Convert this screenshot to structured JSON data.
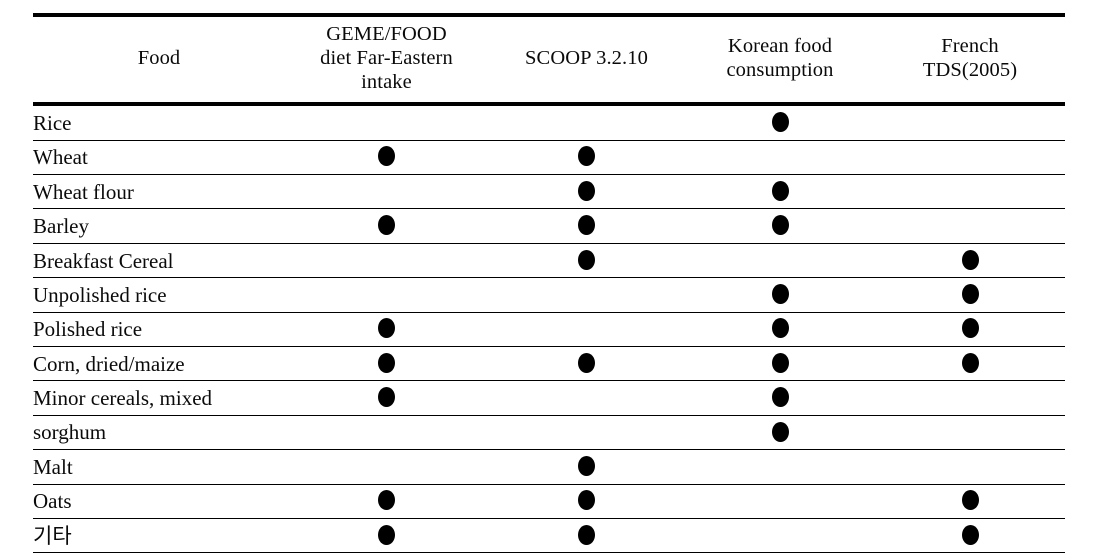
{
  "table": {
    "columns": [
      {
        "key": "food",
        "label_lines": [
          "Food"
        ]
      },
      {
        "key": "gems",
        "label_lines": [
          "GEME/FOOD",
          "diet Far-Eastern",
          "intake"
        ]
      },
      {
        "key": "scoop",
        "label_lines": [
          "SCOOP 3.2.10"
        ]
      },
      {
        "key": "korea",
        "label_lines": [
          "Korean food",
          "consumption"
        ]
      },
      {
        "key": "french",
        "label_lines": [
          "French",
          "TDS(2005)"
        ]
      }
    ],
    "mark_glyph": "●",
    "rows": [
      {
        "food": "Rice",
        "gems": false,
        "scoop": false,
        "korea": true,
        "french": false
      },
      {
        "food": "Wheat",
        "gems": true,
        "scoop": true,
        "korea": false,
        "french": false
      },
      {
        "food": "Wheat flour",
        "gems": false,
        "scoop": true,
        "korea": true,
        "french": false
      },
      {
        "food": "Barley",
        "gems": true,
        "scoop": true,
        "korea": true,
        "french": false
      },
      {
        "food": "Breakfast Cereal",
        "gems": false,
        "scoop": true,
        "korea": false,
        "french": true
      },
      {
        "food": "Unpolished rice",
        "gems": false,
        "scoop": false,
        "korea": true,
        "french": true
      },
      {
        "food": "Polished rice",
        "gems": true,
        "scoop": false,
        "korea": true,
        "french": true
      },
      {
        "food": "Corn, dried/maize",
        "gems": true,
        "scoop": true,
        "korea": true,
        "french": true
      },
      {
        "food": "Minor cereals, mixed",
        "gems": true,
        "scoop": false,
        "korea": true,
        "french": false
      },
      {
        "food": "sorghum",
        "gems": false,
        "scoop": false,
        "korea": true,
        "french": false
      },
      {
        "food": "Malt",
        "gems": false,
        "scoop": true,
        "korea": false,
        "french": false
      },
      {
        "food": "Oats",
        "gems": true,
        "scoop": true,
        "korea": false,
        "french": true
      },
      {
        "food": "기타",
        "gems": true,
        "scoop": true,
        "korea": false,
        "french": true
      }
    ]
  },
  "style": {
    "rule_color": "#000000",
    "text_color": "#0a0a0a",
    "dot_color": "#000000",
    "background": "#ffffff"
  }
}
